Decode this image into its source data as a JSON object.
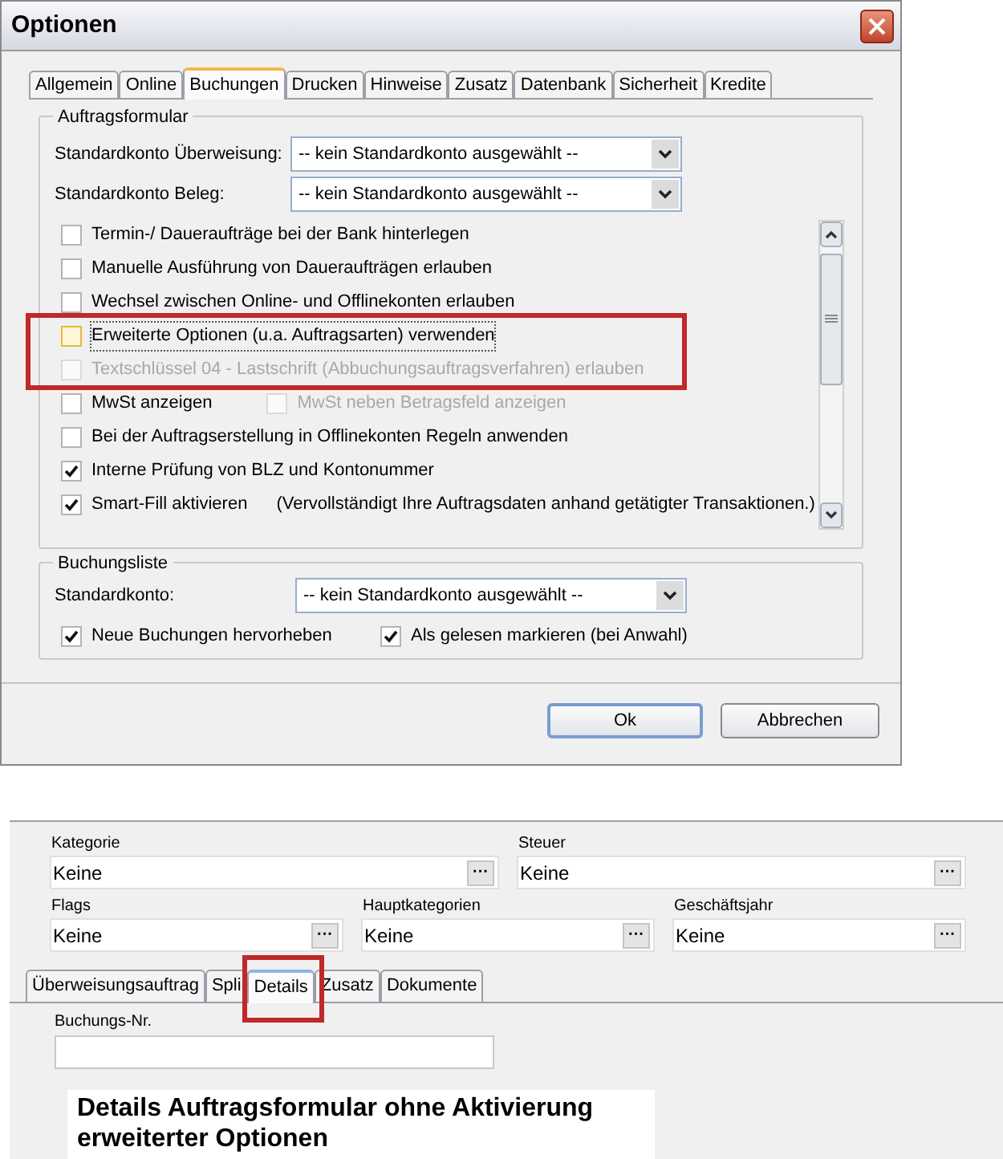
{
  "dialog": {
    "title": "Optionen",
    "tabs": [
      {
        "label": "Allgemein",
        "selected": false
      },
      {
        "label": "Online",
        "selected": false
      },
      {
        "label": "Buchungen",
        "selected": true
      },
      {
        "label": "Drucken",
        "selected": false
      },
      {
        "label": "Hinweise",
        "selected": false
      },
      {
        "label": "Zusatz",
        "selected": false
      },
      {
        "label": "Datenbank",
        "selected": false
      },
      {
        "label": "Sicherheit",
        "selected": false
      },
      {
        "label": "Kredite",
        "selected": false
      }
    ],
    "order_form": {
      "legend": "Auftragsformular",
      "fields": [
        {
          "label": "Standardkonto Überweisung:",
          "value": "-- kein Standardkonto ausgewählt --"
        },
        {
          "label": "Standardkonto Beleg:",
          "value": "-- kein Standardkonto ausgewählt --"
        }
      ],
      "options": [
        {
          "label": "Termin-/ Daueraufträge bei der Bank hinterlegen",
          "checked": false,
          "disabled": false,
          "focused": false
        },
        {
          "label": "Manuelle Ausführung von Daueraufträgen erlauben",
          "checked": false,
          "disabled": false,
          "focused": false
        },
        {
          "label": "Wechsel zwischen Online- und Offlinekonten erlauben",
          "checked": false,
          "disabled": false,
          "focused": false
        },
        {
          "label": "Erweiterte Optionen (u.a. Auftragsarten) verwenden",
          "checked": false,
          "disabled": false,
          "focused": true,
          "highlighted": true
        },
        {
          "label": "Textschlüssel 04 - Lastschrift (Abbuchungsauftragsverfahren) erlauben",
          "checked": false,
          "disabled": true,
          "focused": false,
          "highlighted": true
        },
        {
          "label": "MwSt anzeigen",
          "checked": false,
          "disabled": false,
          "focused": false,
          "extra": {
            "label": "MwSt neben Betragsfeld anzeigen",
            "checked": false,
            "disabled": true
          }
        },
        {
          "label": "Bei der Auftragserstellung in Offlinekonten Regeln anwenden",
          "checked": false,
          "disabled": false,
          "focused": false
        },
        {
          "label": "Interne Prüfung von BLZ und Kontonummer",
          "checked": true,
          "disabled": false,
          "focused": false
        },
        {
          "label": "Smart-Fill aktivieren",
          "checked": true,
          "disabled": false,
          "focused": false,
          "note": "(Vervollständigt Ihre Auftragsdaten anhand getätigter Transaktionen.)"
        }
      ]
    },
    "booking_list": {
      "legend": "Buchungsliste",
      "field": {
        "label": "Standardkonto:",
        "value": "-- kein Standardkonto ausgewählt --"
      },
      "options": [
        {
          "label": "Neue Buchungen hervorheben",
          "checked": true
        },
        {
          "label": "Als gelesen markieren (bei Anwahl)",
          "checked": true
        }
      ]
    },
    "buttons": [
      {
        "label": "Ok",
        "default": true
      },
      {
        "label": "Abbrechen",
        "default": false
      }
    ]
  },
  "detail_form": {
    "field_rows": [
      [
        {
          "label": "Kategorie",
          "value": "Keine"
        },
        {
          "label": "Steuer",
          "value": "Keine"
        }
      ],
      [
        {
          "label": "Flags",
          "value": "Keine"
        },
        {
          "label": "Hauptkategorien",
          "value": "Keine"
        },
        {
          "label": "Geschäftsjahr",
          "value": "Keine"
        }
      ]
    ],
    "browse_button": "···",
    "tabs": [
      {
        "label": "Überweisungsauftrag",
        "selected": false,
        "highlighted": false
      },
      {
        "label": "Spli",
        "selected": false,
        "highlighted": false
      },
      {
        "label": "Details",
        "selected": true,
        "highlighted": true
      },
      {
        "label": "Zusatz",
        "selected": false,
        "highlighted": false
      },
      {
        "label": "Dokumente",
        "selected": false,
        "highlighted": false
      }
    ],
    "booking_number": {
      "label": "Buchungs-Nr."
    }
  },
  "caption": "Details Auftragsformular ohne Aktivierung erweiterter Optionen"
}
